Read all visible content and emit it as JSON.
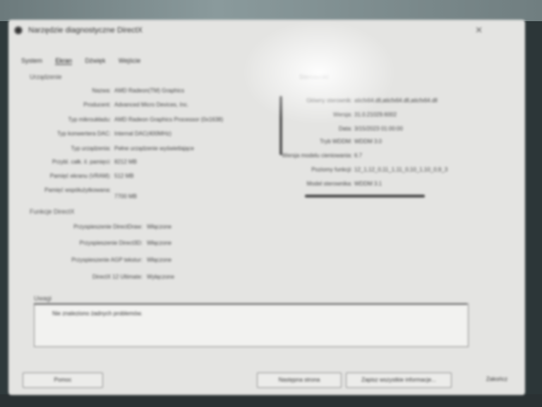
{
  "window": {
    "title": "Narzędzie diagnostyczne DirectX",
    "close_glyph": "✕"
  },
  "tabs": [
    {
      "label": "System"
    },
    {
      "label": "Ekran"
    },
    {
      "label": "Dźwięk"
    },
    {
      "label": "Wejście"
    }
  ],
  "device": {
    "title": "Urządzenie",
    "rows": [
      {
        "label": "Nazwa:",
        "value": "AMD Radeon(TM) Graphics"
      },
      {
        "label": "Producent:",
        "value": "Advanced Micro Devices, Inc."
      },
      {
        "label": "Typ mikroukładu:",
        "value": "AMD Radeon Graphics Processor (0x1638)"
      },
      {
        "label": "Typ konwertera DAC:",
        "value": "Internal DAC(400MHz)"
      },
      {
        "label": "Typ urządzenia:",
        "value": "Pełne urządzenie wyświetlające"
      },
      {
        "label": "Przybl. całk. il. pamięci:",
        "value": "8212 MB"
      },
      {
        "label": "Pamięć ekranu (VRAM):",
        "value": "512 MB"
      },
      {
        "label": "Pamięć współużytkowana:",
        "value": "7700 MB"
      }
    ]
  },
  "directx_features": {
    "title": "Funkcje DirectX",
    "rows": [
      {
        "label": "Przyspieszenie DirectDraw:",
        "value": "Włączone"
      },
      {
        "label": "Przyspieszenie Direct3D:",
        "value": "Włączone"
      },
      {
        "label": "Przyspieszenie AGP tekstur:",
        "value": "Włączone"
      },
      {
        "label": "DirectX 12 Ultimate:",
        "value": "Wyłączone"
      }
    ]
  },
  "drivers": {
    "title": "Sterowniki",
    "rows": [
      {
        "label": "Główny sterownik:",
        "value": "aticfx64.dll,aticfx64.dll,aticfx64.dll"
      },
      {
        "label": "Wersja:",
        "value": "31.0.21029.6002"
      },
      {
        "label": "Data:",
        "value": "3/15/2023 01:00:00"
      },
      {
        "label": "Tryb WDDM:",
        "value": "WDDM 3.0"
      },
      {
        "label": "Wersja modelu cieniowania:",
        "value": "6.7"
      },
      {
        "label": "Poziomy funkcji:",
        "value": "12_1,12_0,11_1,11_0,10_1,10_0,9_3"
      },
      {
        "label": "Model sterownika:",
        "value": "WDDM 3.1"
      }
    ]
  },
  "notes": {
    "title": "Uwagi",
    "text": "Nie znaleziono żadnych problemów."
  },
  "buttons": {
    "help": "Pomoc",
    "next_page": "Następna strona",
    "save_all": "Zapisz wszystkie informacje...",
    "exit": "Zakończ"
  }
}
